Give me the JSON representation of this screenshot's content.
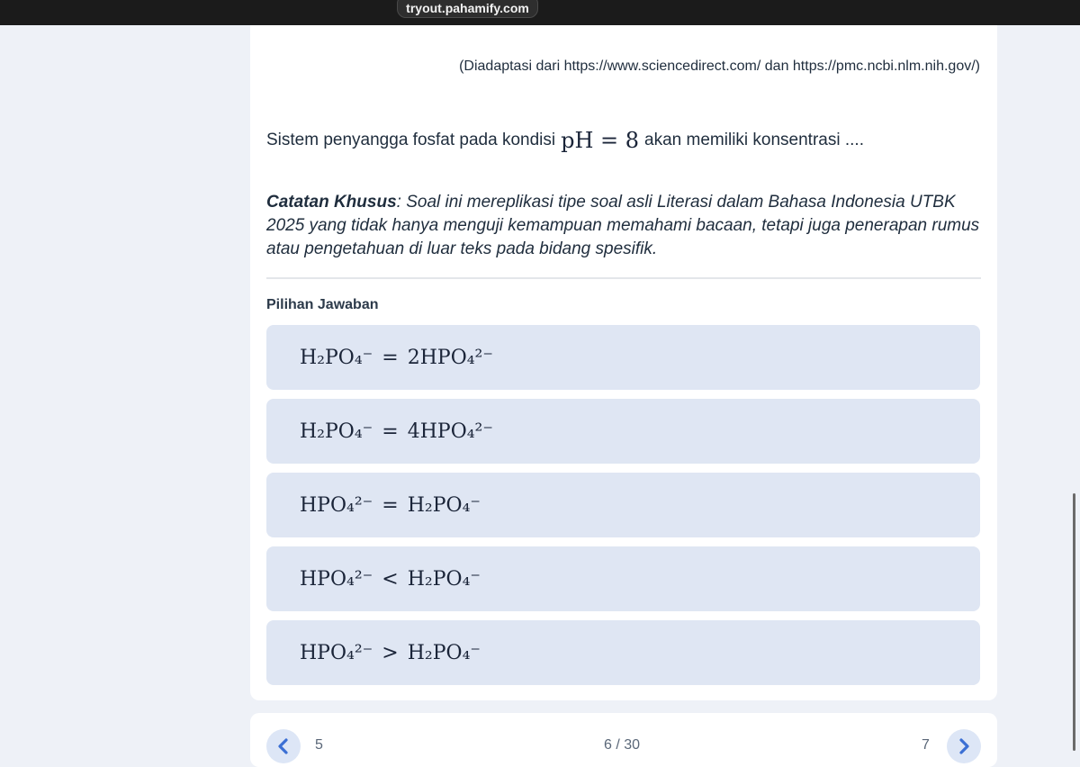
{
  "browser": {
    "url": "tryout.pahamify.com"
  },
  "content": {
    "source_note": "(Diadaptasi dari https://www.sciencedirect.com/ dan https://pmc.ncbi.nlm.nih.gov/)",
    "question_before": "Sistem penyangga fosfat pada kondisi",
    "question_math": "pH = 8",
    "question_after": "akan memiliki konsentrasi ....",
    "note_label": "Catatan Khusus",
    "note_text": ": Soal ini mereplikasi tipe soal asli Literasi dalam Bahasa Indonesia UTBK 2025 yang tidak hanya menguji kemampuan memahami bacaan, tetapi juga penerapan rumus atau pengetahuan di luar teks pada bidang spesifik.",
    "choices_label": "Pilihan Jawaban"
  },
  "options": [
    {
      "left": "H₂PO₄⁻",
      "relation": "=",
      "right": "2HPO₄²⁻"
    },
    {
      "left": "H₂PO₄⁻",
      "relation": "=",
      "right": "4HPO₄²⁻"
    },
    {
      "left": "HPO₄²⁻",
      "relation": "=",
      "right": "H₂PO₄⁻"
    },
    {
      "left": "HPO₄²⁻",
      "relation": "<",
      "right": "H₂PO₄⁻"
    },
    {
      "left": "HPO₄²⁻",
      "relation": ">",
      "right": "H₂PO₄⁻"
    }
  ],
  "pagination": {
    "prev_number": "5",
    "current": "6 / 30",
    "next_number": "7"
  },
  "icons": {
    "prev": "chevron-left-icon",
    "next": "chevron-right-icon"
  },
  "colors": {
    "option_bg": "#dfe6f3",
    "accent": "#3b6fd4"
  }
}
